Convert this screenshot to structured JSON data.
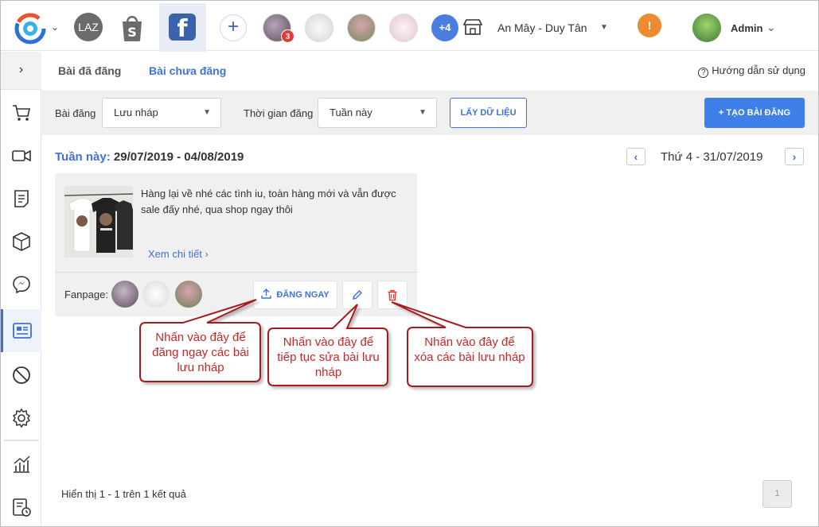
{
  "header": {
    "channels": [
      "LAZ",
      "Shopee",
      "Facebook"
    ],
    "page_badge": "3",
    "more_pages": "+4",
    "store_name": "An Mây - Duy Tân",
    "warning": "!",
    "user_name": "Admin"
  },
  "tabs": {
    "posted": "Bài đã đăng",
    "draft": "Bài chưa đăng",
    "help": "Hướng dẫn sử dụng"
  },
  "filters": {
    "post_label": "Bài đăng",
    "post_value": "Lưu nháp",
    "time_label": "Thời gian đăng",
    "time_value": "Tuần này",
    "fetch_button": "LẤY DỮ LIỆU",
    "create_button": "TẠO BÀI ĐĂNG"
  },
  "week": {
    "label": "Tuần này:",
    "range": "29/07/2019 - 04/08/2019",
    "today": "Thứ 4 - 31/07/2019"
  },
  "post": {
    "content": "Hàng lại về nhé các tình iu, toàn hàng mới và vẫn được sale đấy nhé, qua shop ngay thôi",
    "see_more": "Xem chi tiết",
    "fanpage_label": "Fanpage:",
    "post_now": "ĐĂNG NGAY"
  },
  "callouts": {
    "post_now": "Nhấn vào đây để đăng ngay các bài lưu nháp",
    "edit": "Nhấn vào đây để tiếp tục sửa bài lưu nháp",
    "delete": "Nhấn vào đây để xóa các bài lưu nháp"
  },
  "footer": {
    "result": "Hiển thị 1 - 1 trên 1 kết quả",
    "page": "1"
  },
  "colors": {
    "accent": "#3f72d6",
    "create_button": "#3f7fe8",
    "callout": "#c62828",
    "warning": "#ef8a2e"
  }
}
